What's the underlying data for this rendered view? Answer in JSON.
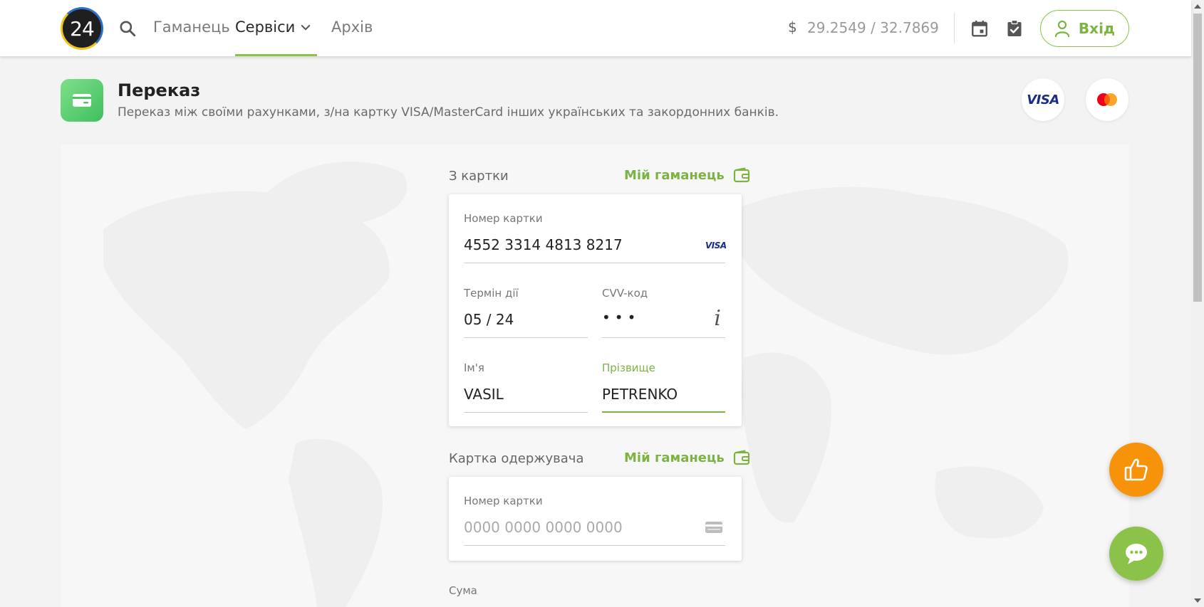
{
  "header": {
    "logo": "24",
    "nav": [
      {
        "label": "Гаманець"
      },
      {
        "label": "Сервіси"
      },
      {
        "label": "Архів"
      }
    ],
    "rate_icon": "$",
    "rate": "29.2549 / 32.7869",
    "login_label": "Вхід",
    "accent_color": "#8bc34a"
  },
  "page": {
    "title": "Переказ",
    "subtitle": "Переказ між своїми рахунками, з/на картку VISA/MasterCard інших українських та закордонних банків.",
    "visa_badge": "VISA"
  },
  "from_card": {
    "section_label": "З картки",
    "wallet_link": "Мій гаманець",
    "card_number_label": "Номер картки",
    "card_number": "4552 3314 4813 8217",
    "card_brand": "VISA",
    "expiry_label": "Термін дії",
    "expiry": "05 / 24",
    "cvv_label": "CVV-код",
    "cvv": "•••",
    "cvv_info": "i",
    "first_name_label": "Ім'я",
    "first_name": "VASIL",
    "last_name_label": "Прізвище",
    "last_name": "PETRENKO"
  },
  "to_card": {
    "section_label": "Картка одержувача",
    "wallet_link": "Мій гаманець",
    "card_number_label": "Номер картки",
    "card_number_placeholder": "0000 0000 0000 0000"
  },
  "amount": {
    "label": "Сума"
  },
  "icons": {
    "search": "search-icon",
    "calendar": "calendar-icon",
    "clipboard": "clipboard-icon",
    "user": "user-icon",
    "wallet": "wallet-icon",
    "like": "thumbs-up-icon",
    "chat": "chat-icon"
  }
}
